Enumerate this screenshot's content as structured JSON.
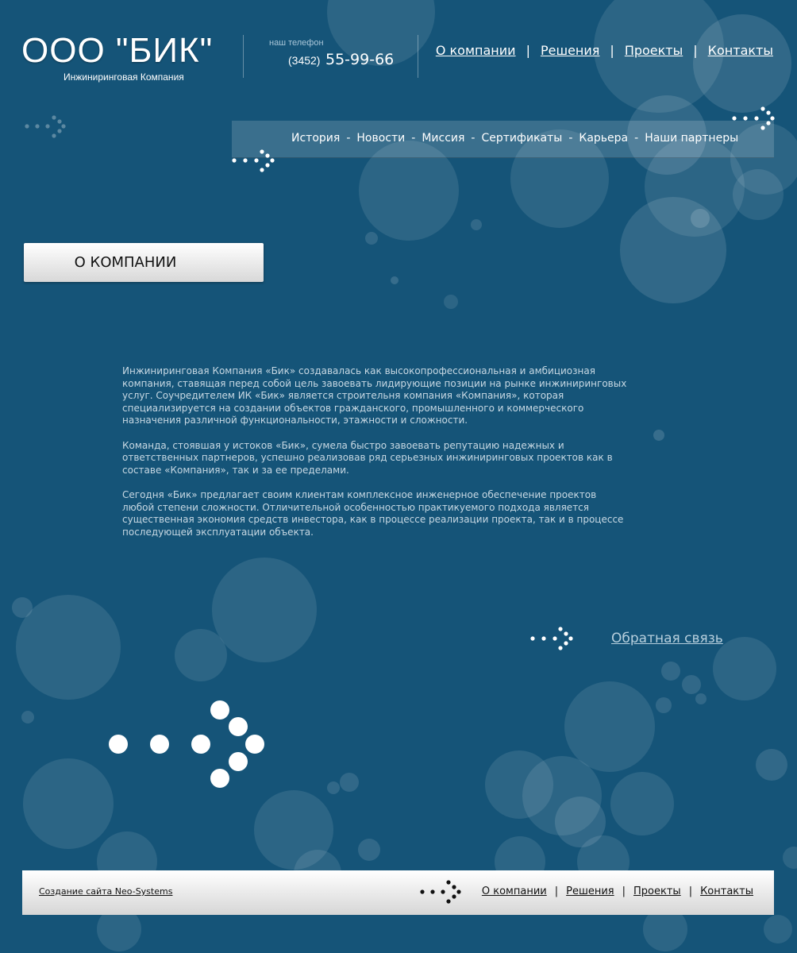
{
  "header": {
    "logo_title": "ООО \"БИК\"",
    "logo_subtitle": "Инжиниринговая Компания",
    "phone_label": "наш телефон",
    "phone_code": "(3452)",
    "phone_number": "55-99-66"
  },
  "top_nav": {
    "items": [
      {
        "label": "О компании"
      },
      {
        "label": "Решения"
      },
      {
        "label": "Проекты"
      },
      {
        "label": "Контакты"
      }
    ],
    "separator": "|"
  },
  "sub_nav": {
    "items": [
      {
        "label": "История"
      },
      {
        "label": "Новости"
      },
      {
        "label": "Миссия"
      },
      {
        "label": "Сертификаты"
      },
      {
        "label": "Карьера"
      },
      {
        "label": "Наши партнеры"
      }
    ],
    "separator": "-"
  },
  "page_title": "О КОМПАНИИ",
  "content": {
    "paragraphs": [
      "Инжиниринговая Компания «Бик» создавалась как высокопрофессиональная и амбициозная компания, ставящая перед собой цель завоевать лидирующие позиции на рынке инжиниринговых услуг. Соучредителем ИК «Бик» является строительня компания «Компания», которая специализируется на создании объектов гражданского, промышленного и коммерческого назначения различной функциональности, этажности и сложности.",
      "Команда, стоявшая у истоков «Бик», сумела быстро завоевать репутацию надежных и ответственных партнеров, успешно реализовав ряд серьезных инжиниринговых проектов как в составе «Компания», так и за ее пределами.",
      "Сегодня «Бик» предлагает своим клиентам комплексное инженерное обеспечение проектов любой степени сложности. Отличительной особенностью практикуемого подхода является существенная экономия средств инвестора, как в процессе реализации проекта, так и в процессе последующей эксплуатации объекта."
    ]
  },
  "feedback_link": "Обратная связь",
  "footer": {
    "credit": "Создание сайта Neo-Systems",
    "nav": [
      {
        "label": "О компании"
      },
      {
        "label": "Решения"
      },
      {
        "label": "Проекты"
      },
      {
        "label": "Контакты"
      }
    ],
    "separator": "|"
  },
  "colors": {
    "background": "#155478",
    "bubble": "#ffffff",
    "content_text": "#c7d8e3"
  },
  "icons": [
    "dots-arrow-icon"
  ]
}
